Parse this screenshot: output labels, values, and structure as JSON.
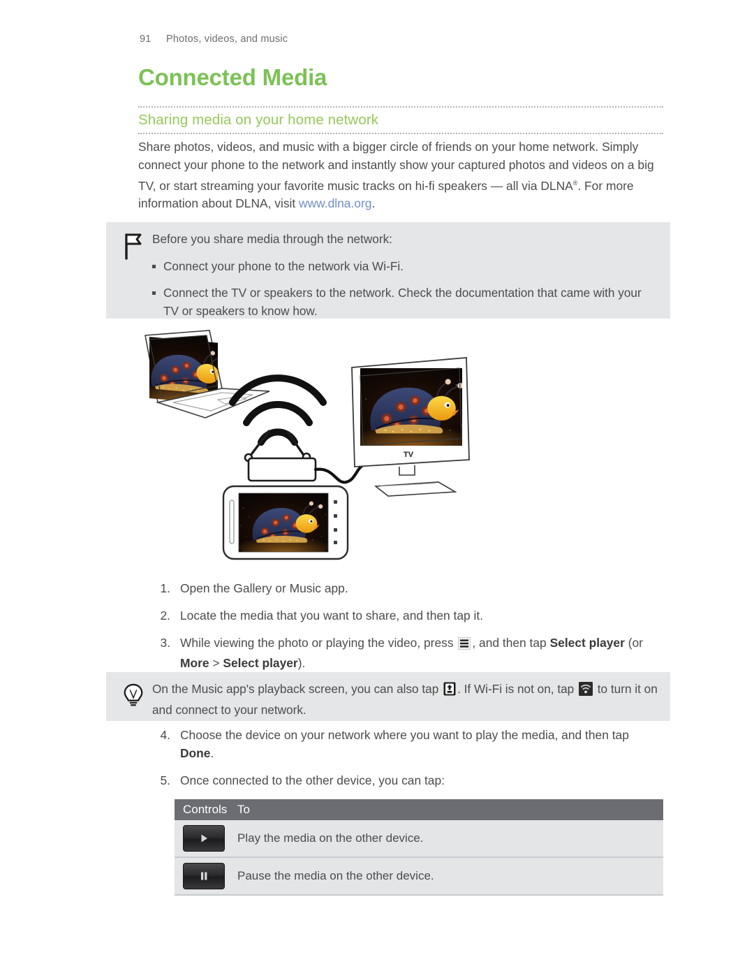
{
  "header": {
    "page_number": "91",
    "section": "Photos, videos, and music"
  },
  "title": "Connected Media",
  "subtitle": "Sharing media on your home network",
  "intro": {
    "part1": "Share photos, videos, and music with a bigger circle of friends on your home network. Simply connect your phone to the network and instantly show your captured photos and videos on a big TV, or start streaming your favorite music tracks on hi-fi speakers — all via DLNA",
    "registered_mark": "®",
    "part2": ". For more information about DLNA, visit ",
    "link": "www.dlna.org",
    "part3": "."
  },
  "note_box": {
    "icon": "flag-icon",
    "lead": "Before you share media through the network:",
    "bullets": [
      "Connect your phone to the network via Wi-Fi.",
      "Connect the TV or speakers to the network. Check the documentation that came with your TV or speakers to know how."
    ]
  },
  "illustration": {
    "tv_label": "TV",
    "devices": [
      "laptop",
      "wireless-router",
      "television",
      "smartphone"
    ],
    "wifi_arcs": 3,
    "description": "Laptop, router and phone connected wirelessly; router wired to a TV. All screens show the same ladybug light sculpture photo."
  },
  "steps_a": [
    {
      "num": "1.",
      "text": "Open the Gallery or Music app."
    },
    {
      "num": "2.",
      "text": "Locate the media that you want to share, and then tap it."
    },
    {
      "num": "3.",
      "text_before_icon": "While viewing the photo or playing the video, press",
      "icon": "menu-icon",
      "text_after_icon": ", and then tap ",
      "bold1": "Select player",
      "mid": " (or ",
      "bold2": "More",
      "mid2": " > ",
      "bold3": "Select player",
      "tail": ")."
    }
  ],
  "tip_box": {
    "icon": "lightbulb-icon",
    "text_before_icon1": "On the Music app's playback screen, you can also tap",
    "icon1": "output-device-icon",
    "text_mid": ". If Wi-Fi is not on, tap",
    "icon2": "wifi-icon",
    "text_after": "to turn it on and connect to your network."
  },
  "steps_b": [
    {
      "num": "4.",
      "text_before": "Choose the device on your network where you want to play the media, and then tap ",
      "bold": "Done",
      "text_after": "."
    },
    {
      "num": "5.",
      "text": "Once connected to the other device, you can tap:"
    }
  ],
  "controls_table": {
    "headers": [
      "Controls",
      "To"
    ],
    "rows": [
      {
        "icon": "play-icon",
        "description": "Play the media on the other device."
      },
      {
        "icon": "pause-icon",
        "description": "Pause the media on the other device."
      }
    ]
  },
  "colors": {
    "title_green": "#7cc156",
    "subtitle_green": "#96c85a",
    "link_blue": "#6f8fc4",
    "callout_gray": "#e5e6e8",
    "table_header_gray": "#6b6d73",
    "table_row_gray": "#e3e5e7",
    "body_text": "#4c4c4c"
  }
}
